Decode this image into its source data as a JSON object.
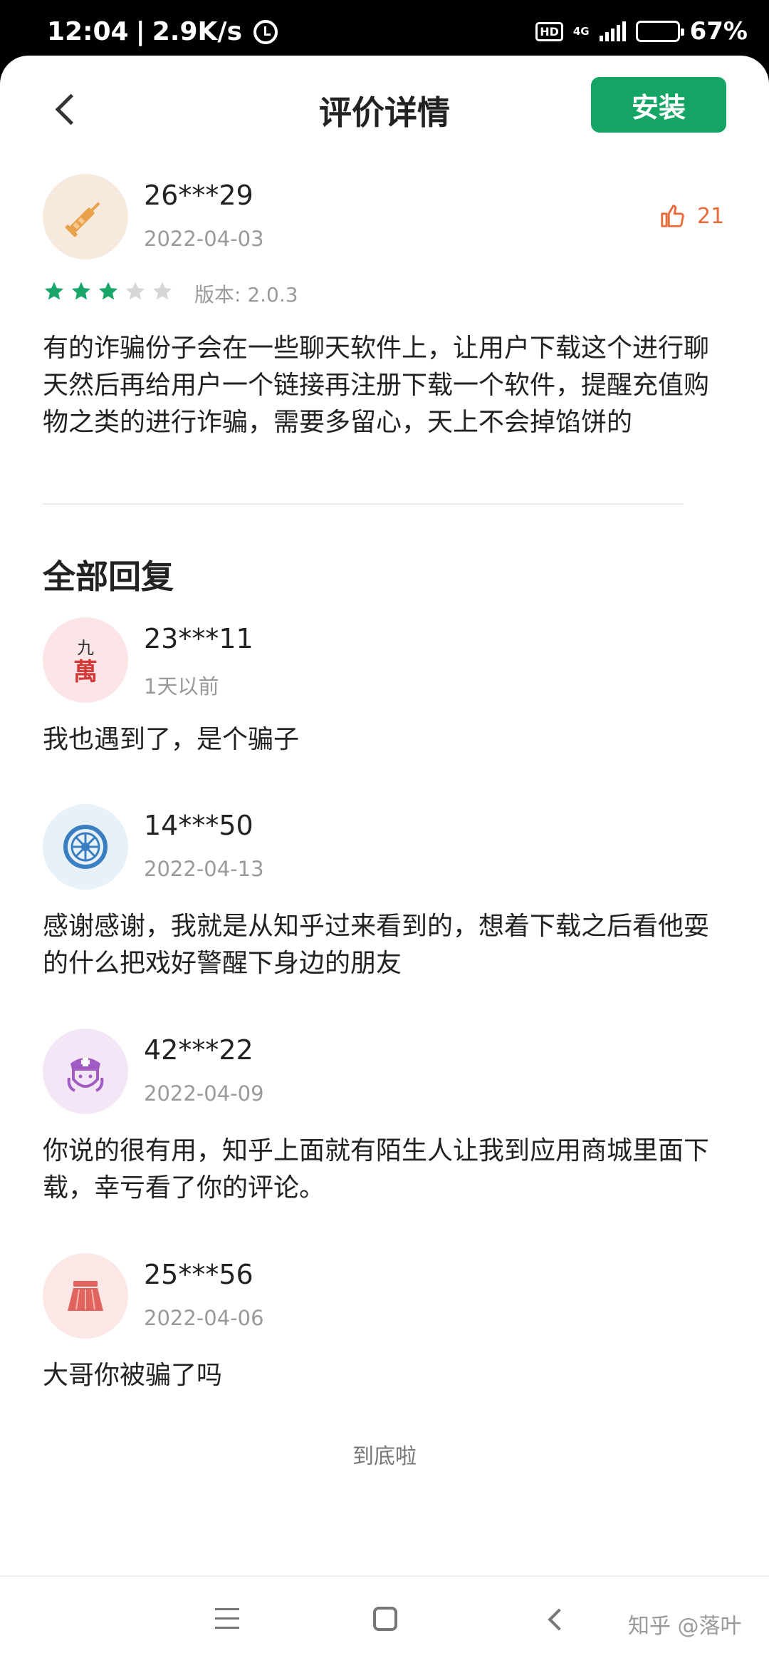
{
  "status_bar": {
    "time": "12:04",
    "speed": "2.9K/s",
    "hd": "HD",
    "network": "4G",
    "battery": "67%",
    "battery_level": 0.67
  },
  "header": {
    "title": "评价详情",
    "install_label": "安装"
  },
  "review": {
    "user": "26***29",
    "date": "2022-04-03",
    "likes": "21",
    "rating": 3,
    "rating_max": 5,
    "version": "版本: 2.0.3",
    "text": "有的诈骗份子会在一些聊天软件上，让用户下载这个进行聊天然后再给用户一个链接再注册下载一个软件，提醒充值购物之类的进行诈骗，需要多留心，天上不会掉馅饼的",
    "avatar_icon": "syringe-icon"
  },
  "replies_title": "全部回复",
  "replies": [
    {
      "user": "23***11",
      "date": "1天以前",
      "text": "我也遇到了，是个骗子",
      "avatar_icon": "mahjong-tile-icon",
      "avatar_glyph_top": "九",
      "avatar_glyph_bottom": "萬"
    },
    {
      "user": "14***50",
      "date": "2022-04-13",
      "text": "感谢感谢，我就是从知乎过来看到的，想着下载之后看他耍的什么把戏好警醒下身边的朋友",
      "avatar_icon": "wheel-icon"
    },
    {
      "user": "42***22",
      "date": "2022-04-09",
      "text": "你说的很有用，知乎上面就有陌生人让我到应用商城里面下载，幸亏看了你的评论。",
      "avatar_icon": "nurse-icon"
    },
    {
      "user": "25***56",
      "date": "2022-04-06",
      "text": "大哥你被骗了吗",
      "avatar_icon": "skirt-icon"
    }
  ],
  "end_note": "到底啦",
  "watermark": "知乎 @落叶",
  "colors": {
    "accent_green": "#14a463",
    "star_green": "#1aa56a",
    "star_empty": "#d6d6d6",
    "like_orange": "#e86b3a"
  }
}
